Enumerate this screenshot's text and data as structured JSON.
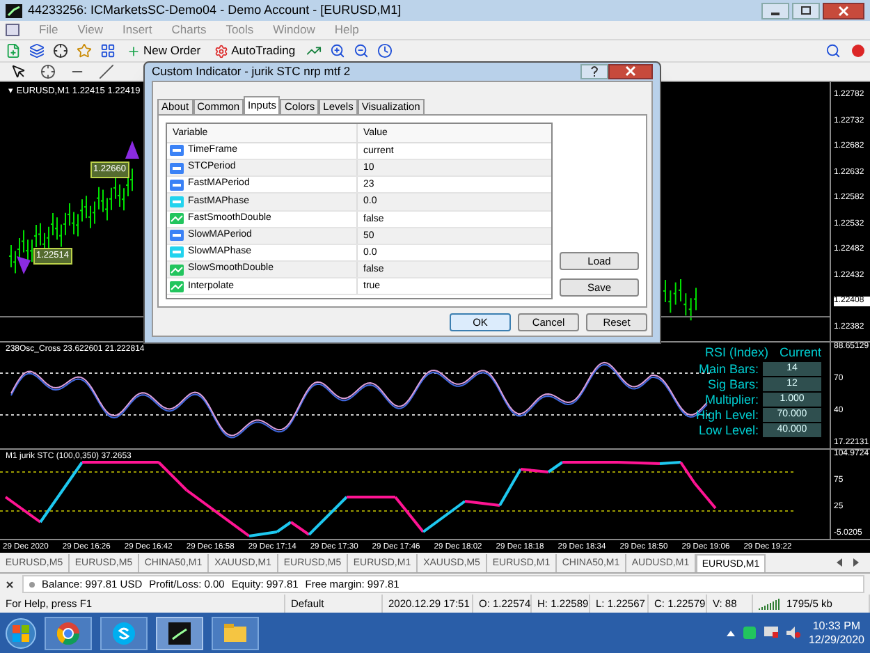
{
  "window": {
    "title": "44233256: ICMarketsSC-Demo04 - Demo Account - [EURUSD,M1]"
  },
  "menu": [
    "File",
    "View",
    "Insert",
    "Charts",
    "Tools",
    "Window",
    "Help"
  ],
  "toolbar": {
    "new_order": "New Order",
    "auto_trading": "AutoTrading"
  },
  "main_chart": {
    "marker": "▾",
    "header": "EURUSD,M1 1.22415 1.22419",
    "price_labels": [
      {
        "text": "1.22660"
      },
      {
        "text": "1.22514"
      }
    ],
    "axis": [
      {
        "text": "1.22782",
        "current": false
      },
      {
        "text": "1.22732",
        "current": false
      },
      {
        "text": "1.22682",
        "current": false
      },
      {
        "text": "1.22632",
        "current": false
      },
      {
        "text": "1.22582",
        "current": false
      },
      {
        "text": "1.22532",
        "current": false
      },
      {
        "text": "1.22482",
        "current": false
      },
      {
        "text": "1.22432",
        "current": false
      },
      {
        "text": "1.22408",
        "current": true
      },
      {
        "text": "1.22382",
        "current": false
      }
    ]
  },
  "osc_pane": {
    "header": "238Osc_Cross 23.622601 21.222814",
    "axis": [
      "88.65129",
      "70",
      "40",
      "17.22131"
    ],
    "panel": {
      "title": "RSI (Index)",
      "mode": "Current",
      "rows": [
        {
          "label": "Main Bars:",
          "value": "14"
        },
        {
          "label": "Sig Bars:",
          "value": "12"
        },
        {
          "label": "Multiplier:",
          "value": "1.000"
        },
        {
          "label": "High Level:",
          "value": "70.000"
        },
        {
          "label": "Low Level:",
          "value": "40.000"
        }
      ]
    }
  },
  "stc_pane": {
    "header": "M1 jurik STC (100,0,350) 37.2653",
    "axis": [
      "104.9724",
      "75",
      "25",
      "-5.0205"
    ]
  },
  "time_axis": [
    "29 Dec 2020",
    "29 Dec 16:26",
    "29 Dec 16:42",
    "29 Dec 16:58",
    "29 Dec 17:14",
    "29 Dec 17:30",
    "29 Dec 17:46",
    "29 Dec 18:02",
    "29 Dec 18:18",
    "29 Dec 18:34",
    "29 Dec 18:50",
    "29 Dec 19:06",
    "29 Dec 19:22"
  ],
  "chart_tabs": [
    {
      "label": "EURUSD,M5",
      "selected": false
    },
    {
      "label": "EURUSD,M5",
      "selected": false
    },
    {
      "label": "CHINA50,M1",
      "selected": false
    },
    {
      "label": "XAUUSD,M1",
      "selected": false
    },
    {
      "label": "EURUSD,M5",
      "selected": false
    },
    {
      "label": "EURUSD,M1",
      "selected": false
    },
    {
      "label": "XAUUSD,M5",
      "selected": false
    },
    {
      "label": "EURUSD,M1",
      "selected": false
    },
    {
      "label": "CHINA50,M1",
      "selected": false
    },
    {
      "label": "AUDUSD,M1",
      "selected": false
    },
    {
      "label": "EURUSD,M1",
      "selected": true
    }
  ],
  "account": [
    "Balance: 997.81 USD",
    "Profit/Loss: 0.00",
    "Equity: 997.81",
    "Free margin: 997.81"
  ],
  "status_bar": [
    "For Help, press F1",
    "Default",
    "2020.12.29 17:51",
    "O: 1.22574",
    "H: 1.22589",
    "L: 1.22567",
    "C: 1.22579",
    "V: 88",
    "1795/5 kb"
  ],
  "dialog": {
    "title": "Custom Indicator - jurik STC nrp mtf 2",
    "tabs": [
      {
        "label": "About",
        "selected": false
      },
      {
        "label": "Common",
        "selected": false
      },
      {
        "label": "Inputs",
        "selected": true
      },
      {
        "label": "Colors",
        "selected": false
      },
      {
        "label": "Levels",
        "selected": false
      },
      {
        "label": "Visualization",
        "selected": false
      }
    ],
    "columns": [
      "Variable",
      "Value"
    ],
    "rows": [
      {
        "kind": "int",
        "name": "TimeFrame",
        "value": "current"
      },
      {
        "kind": "int",
        "name": "STCPeriod",
        "value": "10"
      },
      {
        "kind": "int",
        "name": "FastMAPeriod",
        "value": "23"
      },
      {
        "kind": "double",
        "name": "FastMAPhase",
        "value": "0.0"
      },
      {
        "kind": "bool",
        "name": "FastSmoothDouble",
        "value": "false"
      },
      {
        "kind": "int",
        "name": "SlowMAPeriod",
        "value": "50"
      },
      {
        "kind": "double",
        "name": "SlowMAPhase",
        "value": "0.0"
      },
      {
        "kind": "bool",
        "name": "SlowSmoothDouble",
        "value": "false"
      },
      {
        "kind": "bool",
        "name": "Interpolate",
        "value": "true"
      }
    ],
    "side_buttons": [
      "Load",
      "Save"
    ],
    "buttons": [
      {
        "label": "OK",
        "default": true
      },
      {
        "label": "Cancel",
        "default": false
      },
      {
        "label": "Reset",
        "default": false
      }
    ]
  },
  "taskbar": {
    "time": "10:33 PM",
    "date": "12/29/2020"
  }
}
